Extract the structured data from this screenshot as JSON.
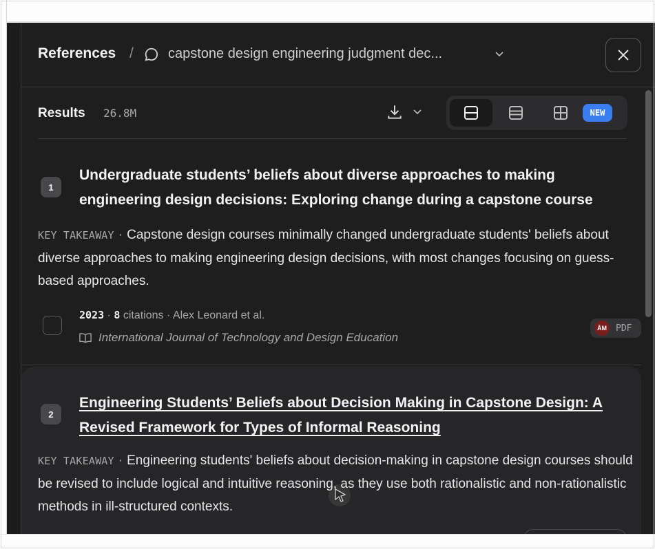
{
  "header": {
    "root": "References",
    "separator": "/",
    "query": "capstone design engineering judgment dec...",
    "close_icon": "close-icon"
  },
  "results_bar": {
    "label": "Results",
    "count": "26.8M",
    "new_badge": "NEW"
  },
  "results": [
    {
      "index": "1",
      "title": "Undergraduate students’ beliefs about diverse approaches to making engineering design decisions: Exploring change during a capstone course",
      "takeaway_label": "KEY TAKEAWAY",
      "takeaway": "Capstone design courses minimally changed undergraduate students' beliefs about diverse approaches to making engineering design decisions, with most changes focusing on guess-based approaches.",
      "year": "2023",
      "citations_count": "8",
      "citations_label": "citations",
      "authors": "Alex Leonard et al.",
      "journal": "International Journal of Technology and Design Education",
      "pdf_label": "PDF",
      "pdf_logo_text": "ĀM"
    },
    {
      "index": "2",
      "title": "Engineering Students’ Beliefs about Decision Making in Capstone Design: A Revised Framework for Types of Informal Reasoning",
      "takeaway_label": "KEY TAKEAWAY",
      "takeaway": "Engineering students' beliefs about decision-making in capstone design courses should be revised to include logical and intuitive reasoning, as they use both rationalistic and non-rationalistic methods in ill-structured contexts."
    }
  ],
  "colors": {
    "panel_bg": "#1e1e1f",
    "accent_blue": "#3b7ef0"
  }
}
